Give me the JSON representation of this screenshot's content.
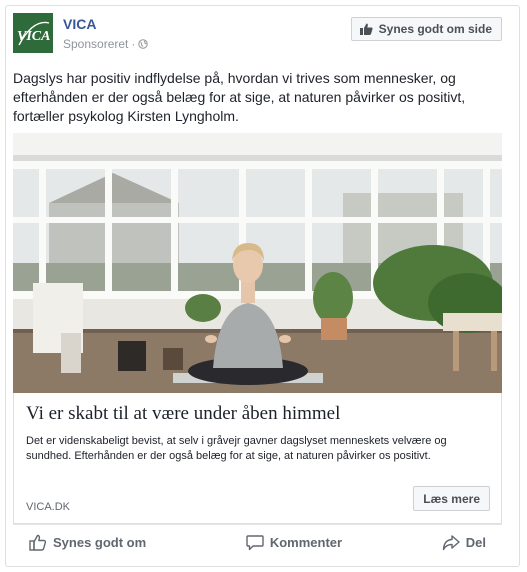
{
  "header": {
    "logo_text": "VICA",
    "page_name": "VICA",
    "sponsored_label": "Sponsoreret",
    "separator": "·",
    "globe_icon": "globe-icon",
    "like_page_label": "Synes godt om side",
    "like_page_icon": "thumbs-up-icon"
  },
  "post": {
    "text": "Dagslys har positiv indflydelse på, hvordan vi trives som mennesker, og efterhånden er der også belæg for at sige, at naturen påvirker os positivt, fortæller psykolog Kirsten Lyngholm."
  },
  "link": {
    "title": "Vi er skabt til at være under åben himmel",
    "description": "Det er videnskabeligt bevist, at selv i gråvejr gavner dagslyset menneskets velvære og sundhed. Efterhånden er der også belæg for at sige, at naturen påvirker os positivt.",
    "domain": "VICA.DK",
    "cta_label": "Læs mere"
  },
  "actions": {
    "like_label": "Synes godt om",
    "like_icon": "thumbs-up-icon",
    "comment_label": "Kommenter",
    "comment_icon": "speech-bubble-icon",
    "share_label": "Del",
    "share_icon": "share-arrow-icon"
  },
  "colors": {
    "page_name": "#365899",
    "meta_text": "#90949c",
    "action_text": "#616770",
    "logo_bg": "#2f6b3a"
  }
}
